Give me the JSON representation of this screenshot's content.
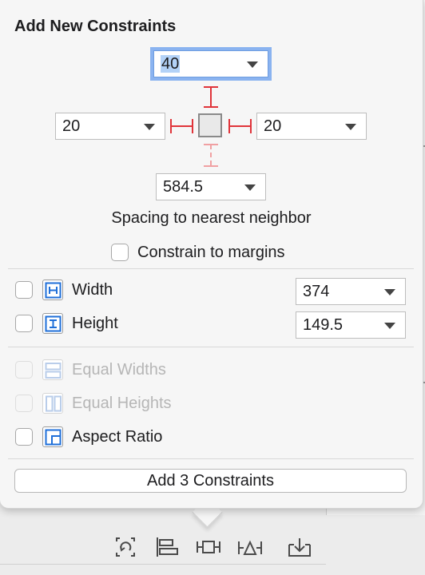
{
  "popover": {
    "title": "Add New Constraints",
    "spacing": {
      "top": "40",
      "left": "20",
      "right": "20",
      "bottom": "584.5",
      "caption": "Spacing to nearest neighbor"
    },
    "constrain_margins_label": "Constrain to margins",
    "dimensions": [
      {
        "label": "Width",
        "value": "374",
        "icon": "width-constraint-icon"
      },
      {
        "label": "Height",
        "value": "149.5",
        "icon": "height-constraint-icon"
      }
    ],
    "equal": [
      {
        "label": "Equal Widths",
        "icon": "equal-widths-icon",
        "enabled": false
      },
      {
        "label": "Equal Heights",
        "icon": "equal-heights-icon",
        "enabled": false
      },
      {
        "label": "Aspect Ratio",
        "icon": "aspect-ratio-icon",
        "enabled": true
      }
    ],
    "add_button_label": "Add 3 Constraints"
  },
  "toolbar": {
    "icons": [
      "update-frames-icon",
      "align-icon",
      "add-constraints-icon",
      "resolve-issues-icon",
      "embed-in-icon"
    ]
  },
  "colors": {
    "accent_focus": "#8ab3f0",
    "constraint_red": "#e0343a",
    "constraint_red_faded": "#f0a0a2",
    "icon_blue": "#1f6fd8"
  }
}
